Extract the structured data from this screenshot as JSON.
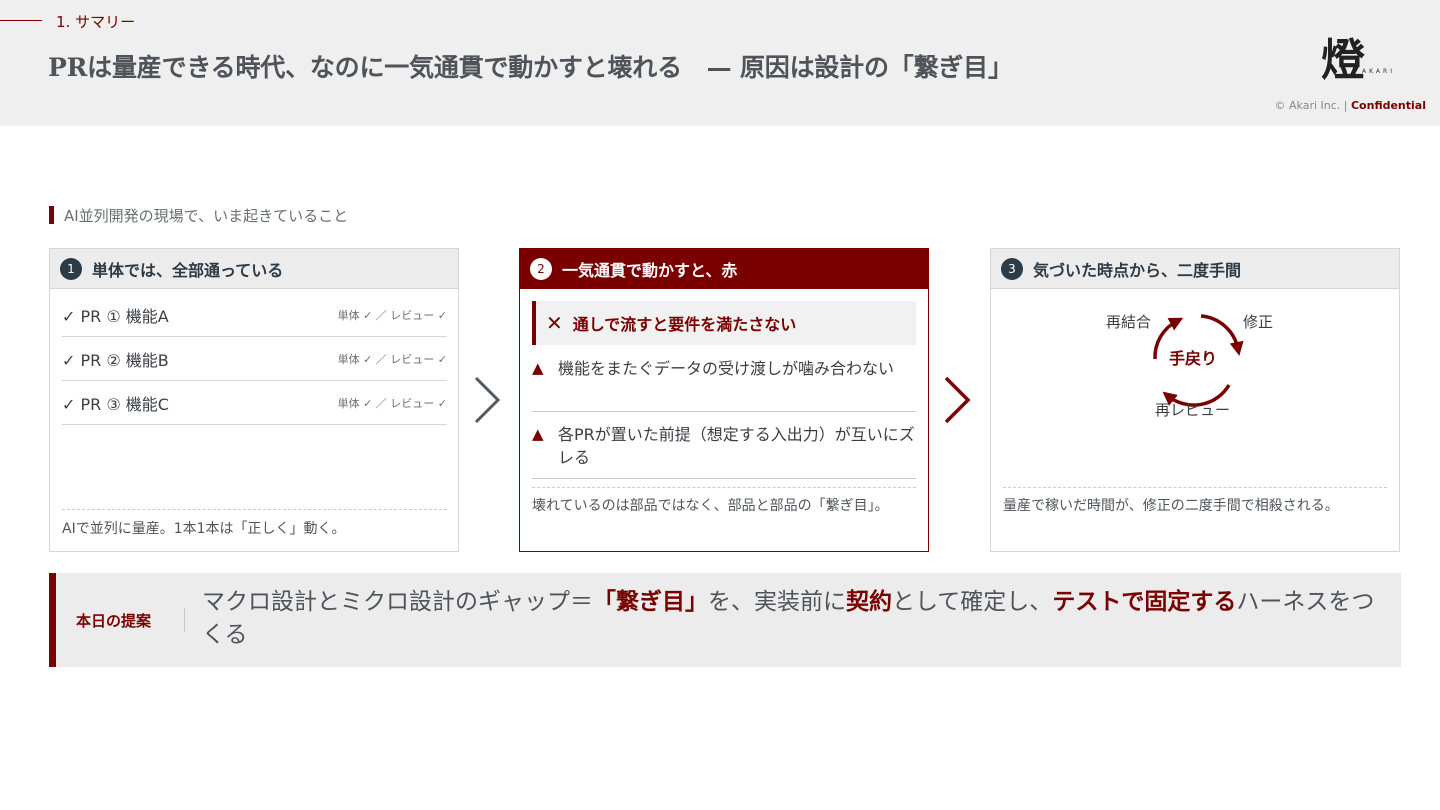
{
  "header": {
    "section_label": "1. サマリー",
    "title": "PRは量産できる時代、なのに一気通貫で動かすと壊れる　— 原因は設計の「繋ぎ目」",
    "copyright": "© Akari Inc. | ",
    "confidential": "Confidential"
  },
  "context": {
    "label": "AI並列開発の現場で、いま起きていること"
  },
  "card1": {
    "num": "1",
    "title": "単体では、全部通っている",
    "rows": [
      {
        "label": "✓  PR ① 機能A",
        "meta": "単体 ✓ ／ レビュー ✓"
      },
      {
        "label": "✓  PR ② 機能B",
        "meta": "単体 ✓ ／ レビュー ✓"
      },
      {
        "label": "✓  PR ③ 機能C",
        "meta": "単体 ✓ ／ レビュー ✓"
      }
    ],
    "footer": "AIで並列に量産。1本1本は「正しく」動く。"
  },
  "card2": {
    "num": "2",
    "title": "一気通貫で動かすと、赤",
    "alert": "通しで流すと要件を満たさない",
    "items": [
      "機能をまたぐデータの受け渡しが噛み合わない",
      "各PRが置いた前提（想定する入出力）が互いにズレる"
    ],
    "footer": "壊れているのは部品ではなく、部品と部品の「繋ぎ目」。"
  },
  "card3": {
    "num": "3",
    "title": "気づいた時点から、二度手間",
    "cycle": {
      "center": "手戻り",
      "top_left": "再結合",
      "top_right": "修正",
      "bottom": "再レビュー"
    },
    "footer": "量産で稼いだ時間が、修正の二度手間で相殺される。"
  },
  "proposal": {
    "label": "本日の提案",
    "text_1": "マクロ設計とミクロ設計のギャップ＝",
    "em_1": "「繋ぎ目」",
    "text_2": "を、実装前に",
    "em_2": "契約",
    "text_3": "として確定し、",
    "em_3": "テストで固定する",
    "text_4": "ハーネスをつくる"
  },
  "colors": {
    "accent": "#7a0000",
    "navy": "#2d3b47",
    "panel": "#ececec"
  },
  "icons": {
    "logo": "akari-lantern-logo",
    "chevron": "chevron-right-icon",
    "cycle": "cycle-arrows-icon"
  }
}
